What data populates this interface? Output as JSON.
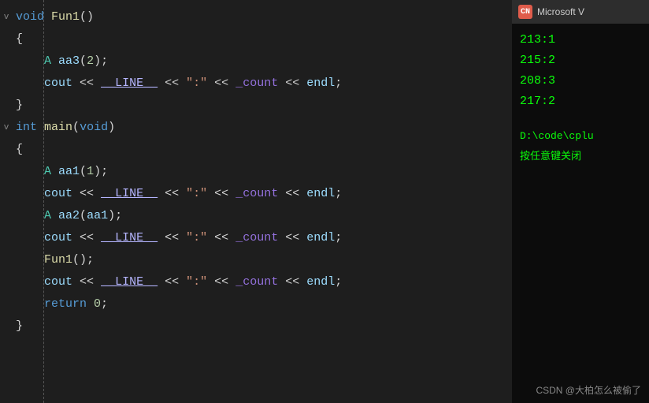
{
  "editor": {
    "lines": [
      {
        "id": 1,
        "indent": 0,
        "fold": "v",
        "tokens": [
          {
            "type": "kw",
            "text": "void"
          },
          {
            "type": "plain",
            "text": " "
          },
          {
            "type": "fn",
            "text": "Fun1"
          },
          {
            "type": "punc",
            "text": "()"
          }
        ]
      },
      {
        "id": 2,
        "indent": 0,
        "fold": "",
        "tokens": [
          {
            "type": "punc",
            "text": "{"
          }
        ]
      },
      {
        "id": 3,
        "indent": 1,
        "fold": "",
        "tokens": [
          {
            "type": "type",
            "text": "A"
          },
          {
            "type": "plain",
            "text": " "
          },
          {
            "type": "var",
            "text": "aa3"
          },
          {
            "type": "punc",
            "text": "("
          },
          {
            "type": "num",
            "text": "2"
          },
          {
            "type": "punc",
            "text": ");"
          }
        ]
      },
      {
        "id": 4,
        "indent": 1,
        "fold": "",
        "tokens": [
          {
            "type": "var",
            "text": "cout"
          },
          {
            "type": "plain",
            "text": " "
          },
          {
            "type": "stream-op",
            "text": "<<"
          },
          {
            "type": "plain",
            "text": " "
          },
          {
            "type": "macro",
            "text": "__LINE__"
          },
          {
            "type": "plain",
            "text": " "
          },
          {
            "type": "stream-op",
            "text": "<<"
          },
          {
            "type": "plain",
            "text": " "
          },
          {
            "type": "str",
            "text": "\":\""
          },
          {
            "type": "plain",
            "text": " "
          },
          {
            "type": "stream-op",
            "text": "<<"
          },
          {
            "type": "plain",
            "text": " "
          },
          {
            "type": "special",
            "text": "_count"
          },
          {
            "type": "plain",
            "text": " "
          },
          {
            "type": "stream-op",
            "text": "<<"
          },
          {
            "type": "plain",
            "text": " "
          },
          {
            "type": "var",
            "text": "endl"
          },
          {
            "type": "punc",
            "text": ";"
          }
        ]
      },
      {
        "id": 5,
        "indent": 0,
        "fold": "",
        "tokens": [
          {
            "type": "punc",
            "text": "}"
          }
        ]
      },
      {
        "id": 6,
        "indent": 0,
        "fold": "v",
        "tokens": [
          {
            "type": "kw",
            "text": "int"
          },
          {
            "type": "plain",
            "text": " "
          },
          {
            "type": "fn",
            "text": "main"
          },
          {
            "type": "punc",
            "text": "("
          },
          {
            "type": "kw",
            "text": "void"
          },
          {
            "type": "punc",
            "text": ")"
          }
        ]
      },
      {
        "id": 7,
        "indent": 0,
        "fold": "",
        "tokens": [
          {
            "type": "punc",
            "text": "{"
          }
        ]
      },
      {
        "id": 8,
        "indent": 1,
        "fold": "",
        "tokens": [
          {
            "type": "type",
            "text": "A"
          },
          {
            "type": "plain",
            "text": " "
          },
          {
            "type": "var",
            "text": "aa1"
          },
          {
            "type": "punc",
            "text": "("
          },
          {
            "type": "num",
            "text": "1"
          },
          {
            "type": "punc",
            "text": ");"
          }
        ]
      },
      {
        "id": 9,
        "indent": 1,
        "fold": "",
        "tokens": [
          {
            "type": "var",
            "text": "cout"
          },
          {
            "type": "plain",
            "text": " "
          },
          {
            "type": "stream-op",
            "text": "<<"
          },
          {
            "type": "plain",
            "text": " "
          },
          {
            "type": "macro",
            "text": "__LINE__"
          },
          {
            "type": "plain",
            "text": " "
          },
          {
            "type": "stream-op",
            "text": "<<"
          },
          {
            "type": "plain",
            "text": " "
          },
          {
            "type": "str",
            "text": "\":\""
          },
          {
            "type": "plain",
            "text": " "
          },
          {
            "type": "stream-op",
            "text": "<<"
          },
          {
            "type": "plain",
            "text": " "
          },
          {
            "type": "special",
            "text": "_count"
          },
          {
            "type": "plain",
            "text": " "
          },
          {
            "type": "stream-op",
            "text": "<<"
          },
          {
            "type": "plain",
            "text": " "
          },
          {
            "type": "var",
            "text": "endl"
          },
          {
            "type": "punc",
            "text": ";"
          }
        ]
      },
      {
        "id": 10,
        "indent": 1,
        "fold": "",
        "tokens": [
          {
            "type": "type",
            "text": "A"
          },
          {
            "type": "plain",
            "text": " "
          },
          {
            "type": "var",
            "text": "aa2"
          },
          {
            "type": "punc",
            "text": "("
          },
          {
            "type": "var",
            "text": "aa1"
          },
          {
            "type": "punc",
            "text": ");"
          }
        ]
      },
      {
        "id": 11,
        "indent": 1,
        "fold": "",
        "tokens": [
          {
            "type": "var",
            "text": "cout"
          },
          {
            "type": "plain",
            "text": " "
          },
          {
            "type": "stream-op",
            "text": "<<"
          },
          {
            "type": "plain",
            "text": " "
          },
          {
            "type": "macro",
            "text": "__LINE__"
          },
          {
            "type": "plain",
            "text": " "
          },
          {
            "type": "stream-op",
            "text": "<<"
          },
          {
            "type": "plain",
            "text": " "
          },
          {
            "type": "str",
            "text": "\":\""
          },
          {
            "type": "plain",
            "text": " "
          },
          {
            "type": "stream-op",
            "text": "<<"
          },
          {
            "type": "plain",
            "text": " "
          },
          {
            "type": "special",
            "text": "_count"
          },
          {
            "type": "plain",
            "text": " "
          },
          {
            "type": "stream-op",
            "text": "<<"
          },
          {
            "type": "plain",
            "text": " "
          },
          {
            "type": "var",
            "text": "endl"
          },
          {
            "type": "punc",
            "text": ";"
          }
        ]
      },
      {
        "id": 12,
        "indent": 1,
        "fold": "",
        "tokens": [
          {
            "type": "fn",
            "text": "Fun1"
          },
          {
            "type": "punc",
            "text": "();"
          }
        ]
      },
      {
        "id": 13,
        "indent": 1,
        "fold": "",
        "tokens": [
          {
            "type": "var",
            "text": "cout"
          },
          {
            "type": "plain",
            "text": " "
          },
          {
            "type": "stream-op",
            "text": "<<"
          },
          {
            "type": "plain",
            "text": " "
          },
          {
            "type": "macro",
            "text": "__LINE__"
          },
          {
            "type": "plain",
            "text": " "
          },
          {
            "type": "stream-op",
            "text": "<<"
          },
          {
            "type": "plain",
            "text": " "
          },
          {
            "type": "str",
            "text": "\":\""
          },
          {
            "type": "plain",
            "text": " "
          },
          {
            "type": "stream-op",
            "text": "<<"
          },
          {
            "type": "plain",
            "text": " "
          },
          {
            "type": "special",
            "text": "_count"
          },
          {
            "type": "plain",
            "text": " "
          },
          {
            "type": "stream-op",
            "text": "<<"
          },
          {
            "type": "plain",
            "text": " "
          },
          {
            "type": "var",
            "text": "endl"
          },
          {
            "type": "punc",
            "text": ";"
          }
        ]
      },
      {
        "id": 14,
        "indent": 1,
        "fold": "",
        "tokens": [
          {
            "type": "kw",
            "text": "return"
          },
          {
            "type": "plain",
            "text": " "
          },
          {
            "type": "num",
            "text": "0"
          },
          {
            "type": "punc",
            "text": ";"
          }
        ]
      },
      {
        "id": 15,
        "indent": 0,
        "fold": "",
        "tokens": [
          {
            "type": "punc",
            "text": "}"
          }
        ]
      }
    ]
  },
  "terminal": {
    "title": "Microsoft V",
    "icon_label": "CN",
    "output_lines": [
      "213:1",
      "215:2",
      "208:3",
      "217:2"
    ],
    "path_text": "D:\\code\\cplu",
    "exit_text": "按任意键关闭"
  },
  "watermark": {
    "text": "CSDN @大柏怎么被偷了"
  }
}
